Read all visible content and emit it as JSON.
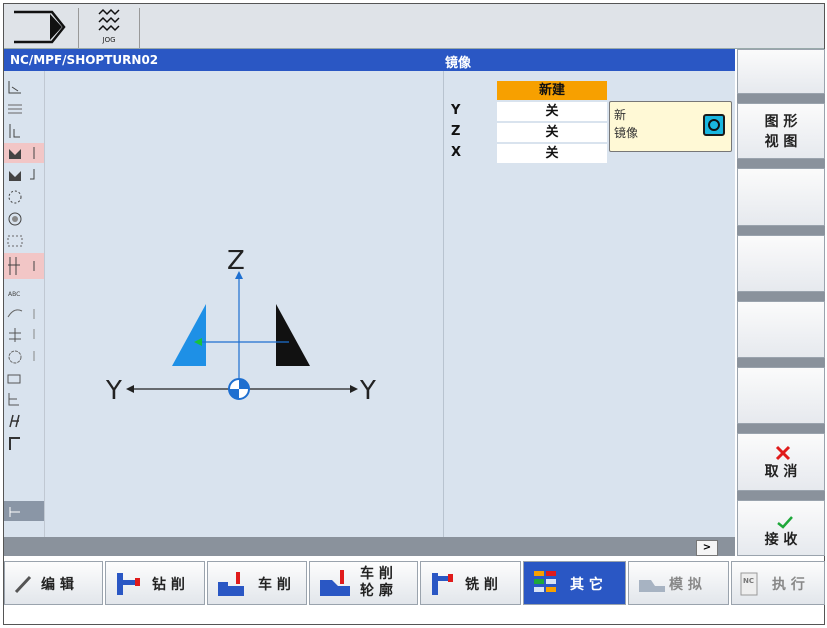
{
  "top_bar": {
    "jog_label": "JOG"
  },
  "header": {
    "path": "NC/MPF/SHOPTURN02",
    "title": "镜像"
  },
  "params": {
    "header_value": "新建",
    "rows": [
      {
        "label": "Y",
        "value": "关"
      },
      {
        "label": "Z",
        "value": "关"
      },
      {
        "label": "X",
        "value": "关"
      }
    ]
  },
  "tooltip": {
    "line1": "新",
    "line2": "镜像"
  },
  "diagram": {
    "axis_vertical": "Z",
    "axis_left": "Y",
    "axis_right": "Y"
  },
  "status": {
    "more_label": ">"
  },
  "right_softkeys": {
    "graphic_view": [
      "图 形",
      "视 图"
    ],
    "cancel": "取 消",
    "accept": "接 收"
  },
  "bottom_softkeys": {
    "edit": "编 辑",
    "drill": "钻 削",
    "turn": "车 削",
    "contour": [
      "车 削",
      "轮 廓"
    ],
    "mill": "铣 削",
    "other": "其 它",
    "simulate": "模 拟",
    "execute": "执 行"
  },
  "colors": {
    "header_blue": "#2a57c4",
    "param_orange": "#f7a000",
    "tooltip_yellow": "#fff9d6",
    "canvas": "#d9e3ee",
    "mirror_blue": "#1e90e6"
  }
}
